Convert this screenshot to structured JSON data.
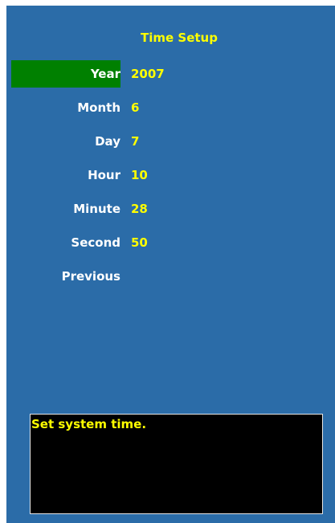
{
  "title": "Time Setup",
  "fields": {
    "year": {
      "label": "Year",
      "value": "2007"
    },
    "month": {
      "label": "Month",
      "value": "6"
    },
    "day": {
      "label": "Day",
      "value": "7"
    },
    "hour": {
      "label": "Hour",
      "value": "10"
    },
    "minute": {
      "label": "Minute",
      "value": "28"
    },
    "second": {
      "label": "Second",
      "value": "50"
    }
  },
  "previous_label": "Previous",
  "help_text": "Set system time.",
  "colors": {
    "background": "#2b6ca8",
    "selection": "#008000",
    "value_text": "#ffff00",
    "label_text": "#ffffff",
    "help_background": "#000000"
  }
}
